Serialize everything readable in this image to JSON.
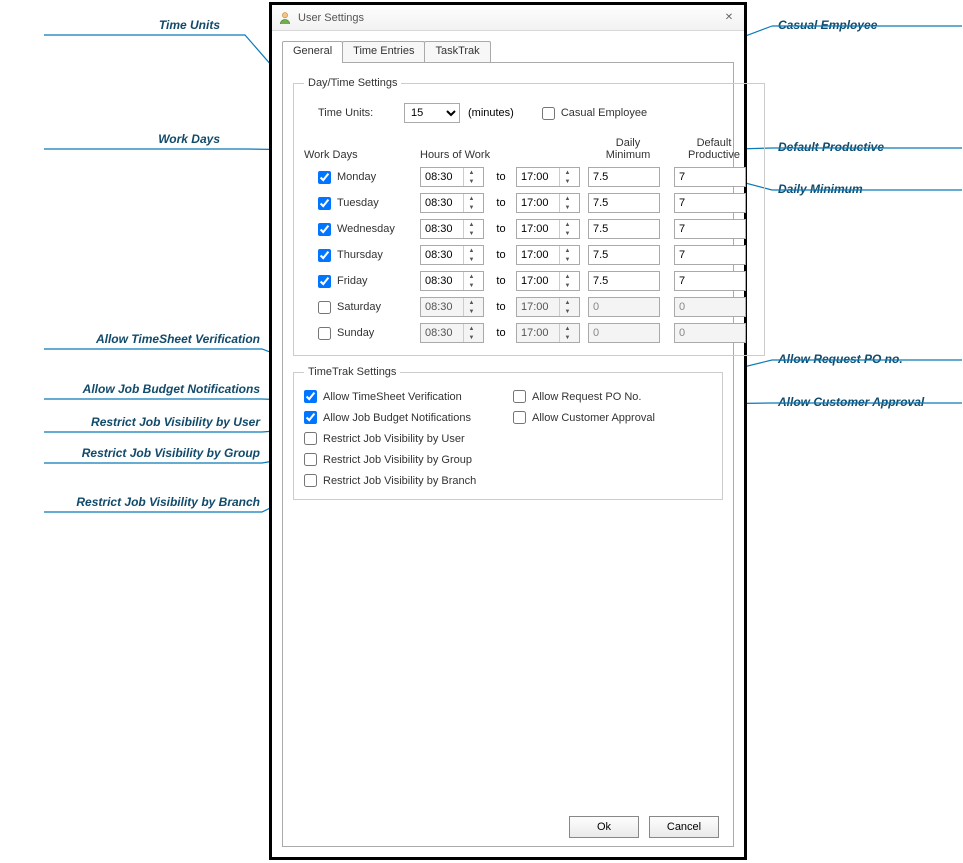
{
  "callouts": {
    "timeUnits": "Time Units",
    "workDays": "Work Days",
    "allowTimesheet": "Allow TimeSheet Verification",
    "allowJobBudget": "Allow Job Budget Notifications",
    "restrictUser": "Restrict Job Visibility by User",
    "restrictGroup": "Restrict Job Visibility by Group",
    "restrictBranch": "Restrict Job Visibility by Branch",
    "casualEmployee": "Casual Employee",
    "defaultProductive": "Default Productive",
    "dailyMinimum": "Daily Minimum",
    "allowRequestPO": "Allow Request PO no.",
    "allowCustomerApproval": "Allow Customer Approval"
  },
  "window": {
    "title": "User Settings"
  },
  "tabs": {
    "general": "General",
    "timeEntries": "Time Entries",
    "taskTrak": "TaskTrak"
  },
  "dayTime": {
    "legend": "Day/Time Settings",
    "timeUnitsLabel": "Time Units:",
    "timeUnitsValue": "15",
    "timeUnitsSuffix": "(minutes)",
    "casualEmployeeLabel": "Casual Employee",
    "headers": {
      "workDays": "Work Days",
      "hoursOfWork": "Hours of Work",
      "dailyMinimum": "Daily\nMinimum",
      "defaultProductive": "Default\nProductive"
    },
    "to": "to",
    "days": [
      {
        "name": "Monday",
        "checked": true,
        "start": "08:30",
        "end": "17:00",
        "min": "7.5",
        "prod": "7",
        "disabled": false
      },
      {
        "name": "Tuesday",
        "checked": true,
        "start": "08:30",
        "end": "17:00",
        "min": "7.5",
        "prod": "7",
        "disabled": false
      },
      {
        "name": "Wednesday",
        "checked": true,
        "start": "08:30",
        "end": "17:00",
        "min": "7.5",
        "prod": "7",
        "disabled": false
      },
      {
        "name": "Thursday",
        "checked": true,
        "start": "08:30",
        "end": "17:00",
        "min": "7.5",
        "prod": "7",
        "disabled": false
      },
      {
        "name": "Friday",
        "checked": true,
        "start": "08:30",
        "end": "17:00",
        "min": "7.5",
        "prod": "7",
        "disabled": false
      },
      {
        "name": "Saturday",
        "checked": false,
        "start": "08:30",
        "end": "17:00",
        "min": "0",
        "prod": "0",
        "disabled": true
      },
      {
        "name": "Sunday",
        "checked": false,
        "start": "08:30",
        "end": "17:00",
        "min": "0",
        "prod": "0",
        "disabled": true
      }
    ]
  },
  "timeTrak": {
    "legend": "TimeTrak Settings",
    "left": [
      {
        "label": "Allow TimeSheet Verification",
        "checked": true
      },
      {
        "label": "Allow Job Budget Notifications",
        "checked": true
      },
      {
        "label": "Restrict Job Visibility by User",
        "checked": false
      },
      {
        "label": "Restrict Job Visibility by Group",
        "checked": false
      },
      {
        "label": "Restrict Job Visibility by Branch",
        "checked": false
      }
    ],
    "right": [
      {
        "label": "Allow Request PO No.",
        "checked": false
      },
      {
        "label": "Allow Customer Approval",
        "checked": false
      }
    ]
  },
  "buttons": {
    "ok": "Ok",
    "cancel": "Cancel"
  }
}
